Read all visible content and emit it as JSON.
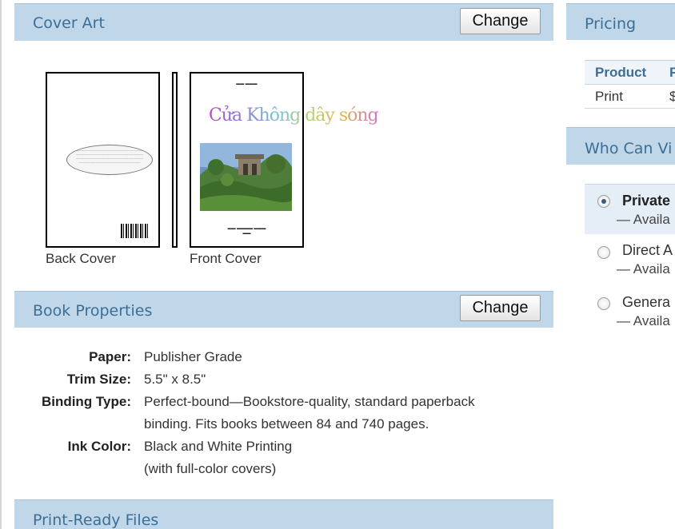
{
  "cover_art": {
    "title": "Cover Art",
    "change_label": "Change",
    "back_cover_label": "Back Cover",
    "front_cover_label": "Front Cover",
    "front_cover_title": "Cửa Không dây sóng"
  },
  "book_properties": {
    "title": "Book Properties",
    "change_label": "Change",
    "rows": [
      {
        "key": "Paper:",
        "lines": [
          "Publisher Grade"
        ]
      },
      {
        "key": "Trim Size:",
        "lines": [
          "5.5\" x 8.5\""
        ]
      },
      {
        "key": "Binding Type:",
        "lines": [
          "Perfect-bound—Bookstore-quality, standard paperback",
          "binding. Fits books between 84 and 740 pages."
        ]
      },
      {
        "key": "Ink Color:",
        "lines": [
          "Black and White Printing",
          "(with full-color covers)"
        ]
      }
    ]
  },
  "print_ready": {
    "title": "Print-Ready Files"
  },
  "pricing": {
    "title": "Pricing",
    "columns": [
      "Product",
      "P"
    ],
    "rows": [
      [
        "Print",
        "$"
      ]
    ]
  },
  "visibility": {
    "title": "Who Can Vi",
    "options": [
      {
        "label": "Private",
        "desc": "— Availa",
        "selected": true
      },
      {
        "label": "Direct A",
        "desc": "— Availa",
        "selected": false
      },
      {
        "label": "Genera",
        "desc": "— Availa",
        "selected": false
      }
    ]
  },
  "colors": {
    "header_bg": "#bfd7e8",
    "header_text": "#3c6e96",
    "selected_bg": "#e5eef6"
  }
}
